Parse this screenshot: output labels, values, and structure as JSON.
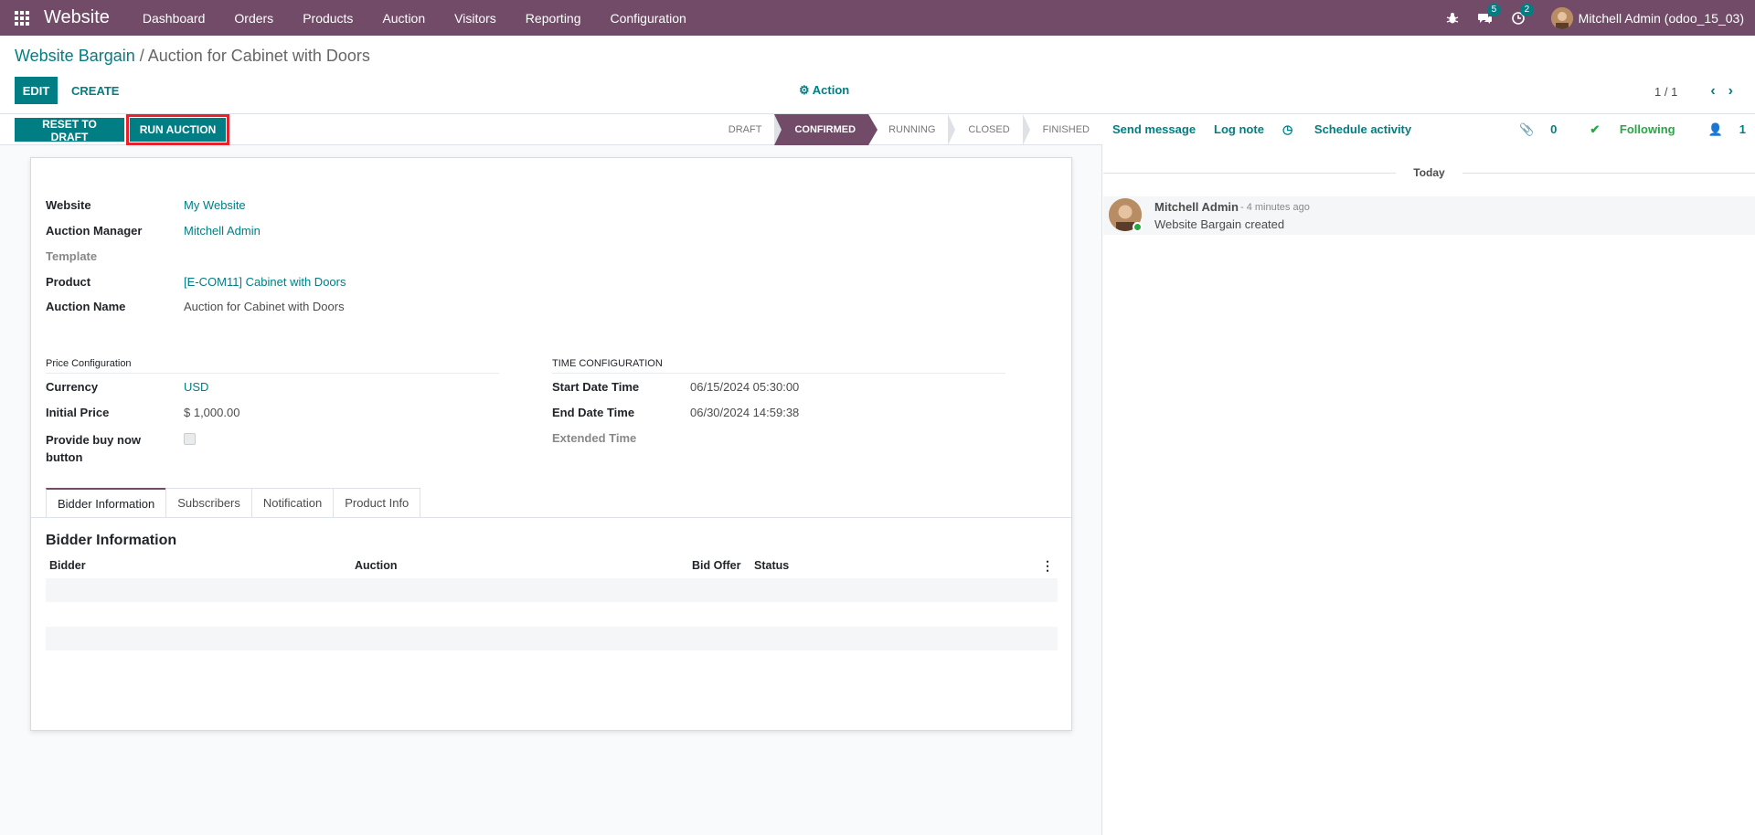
{
  "navbar": {
    "brand": "Website",
    "menu": [
      "Dashboard",
      "Orders",
      "Products",
      "Auction",
      "Visitors",
      "Reporting",
      "Configuration"
    ],
    "chat_badge": "5",
    "activity_badge": "2",
    "user": "Mitchell Admin (odoo_15_03)"
  },
  "breadcrumb": {
    "parent": "Website Bargain",
    "separator": " / ",
    "current": "Auction for Cabinet with Doors"
  },
  "control": {
    "edit_label": "EDIT",
    "create_label": "CREATE",
    "action_label": "Action",
    "pager_value": "1 / 1"
  },
  "statusbar": {
    "reset_label": "RESET TO DRAFT",
    "run_label": "RUN AUCTION",
    "stages": [
      "DRAFT",
      "CONFIRMED",
      "RUNNING",
      "CLOSED",
      "FINISHED"
    ],
    "active_stage": "CONFIRMED"
  },
  "form": {
    "website_label": "Website",
    "website_value": "My Website",
    "manager_label": "Auction Manager",
    "manager_value": "Mitchell Admin",
    "template_label": "Template",
    "product_label": "Product",
    "product_value": "[E-COM11] Cabinet with Doors",
    "auction_name_label": "Auction Name",
    "auction_name_value": "Auction for Cabinet with Doors",
    "price_section": "Price Configuration",
    "currency_label": "Currency",
    "currency_value": "USD",
    "initial_price_label": "Initial Price",
    "initial_price_value": "$ 1,000.00",
    "buy_now_label_1": "Provide buy now",
    "buy_now_label_2": "button",
    "time_section": "TIME CONFIGURATION",
    "start_label": "Start Date Time",
    "start_value": "06/15/2024 05:30:00",
    "end_label": "End Date Time",
    "end_value": "06/30/2024 14:59:38",
    "extended_label": "Extended Time"
  },
  "tabs": [
    "Bidder Information",
    "Subscribers",
    "Notification",
    "Product Info"
  ],
  "bidder_table": {
    "title": "Bidder Information",
    "columns": [
      "Bidder",
      "Auction",
      "Bid Offer",
      "Status"
    ]
  },
  "chatter": {
    "send_message": "Send message",
    "log_note": "Log note",
    "schedule_activity": "Schedule activity",
    "attachments_count": "0",
    "following": "Following",
    "followers_count": "1",
    "today": "Today",
    "message_author": "Mitchell Admin",
    "message_time": "- 4 minutes ago",
    "message_body": "Website Bargain created"
  }
}
